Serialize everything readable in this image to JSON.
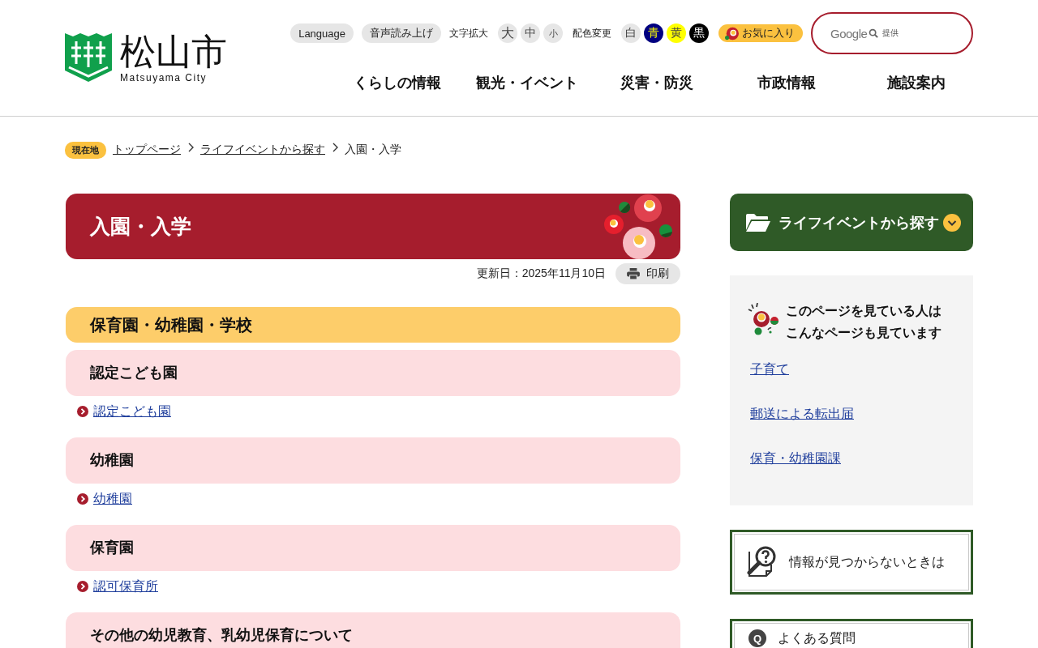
{
  "header": {
    "logo": {
      "name": "松山市",
      "subtitle": "Matsuyama City"
    },
    "utility": {
      "language": "Language",
      "speech": "音声読み上げ",
      "font_size_label": "文字拡大",
      "font_sizes": [
        {
          "label": "大"
        },
        {
          "label": "中"
        },
        {
          "label": "小"
        }
      ],
      "color_label": "配色変更",
      "color_schemes": [
        {
          "label": "白",
          "color": "#e6e6e6"
        },
        {
          "label": "青",
          "color": "#000080"
        },
        {
          "label": "黄",
          "color": "#ffff00"
        },
        {
          "label": "黒",
          "color": "#000000"
        }
      ],
      "favorites": "お気に入り"
    },
    "search": {
      "brand": "Google",
      "note": "提供"
    },
    "nav": [
      "くらしの情報",
      "観光・イベント",
      "災害・防災",
      "市政情報",
      "施設案内"
    ]
  },
  "breadcrumb": {
    "label": "現在地",
    "items": [
      {
        "text": "トップページ",
        "link": true
      },
      {
        "text": "ライフイベントから探す",
        "link": true
      },
      {
        "text": "入園・入学",
        "link": false
      }
    ]
  },
  "page": {
    "title": "入園・入学",
    "updated": "更新日：2025年11月10日",
    "print": "印刷"
  },
  "sections": [
    {
      "heading": "保育園・幼稚園・学校",
      "subsections": [
        {
          "heading": "認定こども園",
          "links": [
            "認定こども園"
          ]
        },
        {
          "heading": "幼稚園",
          "links": [
            "幼稚園"
          ]
        },
        {
          "heading": "保育園",
          "links": [
            "認可保育所"
          ]
        },
        {
          "heading": "その他の幼児教育、乳幼児保育について"
        }
      ]
    }
  ],
  "sidebar": {
    "life_event": "ライフイベントから探す",
    "related": {
      "title": "このページを見ている人はこんなページも見ています",
      "links": [
        "子育て",
        "郵送による転出届",
        "保育・幼稚園課"
      ]
    },
    "help": [
      {
        "kind": "not-found",
        "text": "情報が見つからないときは"
      },
      {
        "kind": "faq",
        "badge": "Q",
        "text": "よくある質問"
      }
    ]
  }
}
